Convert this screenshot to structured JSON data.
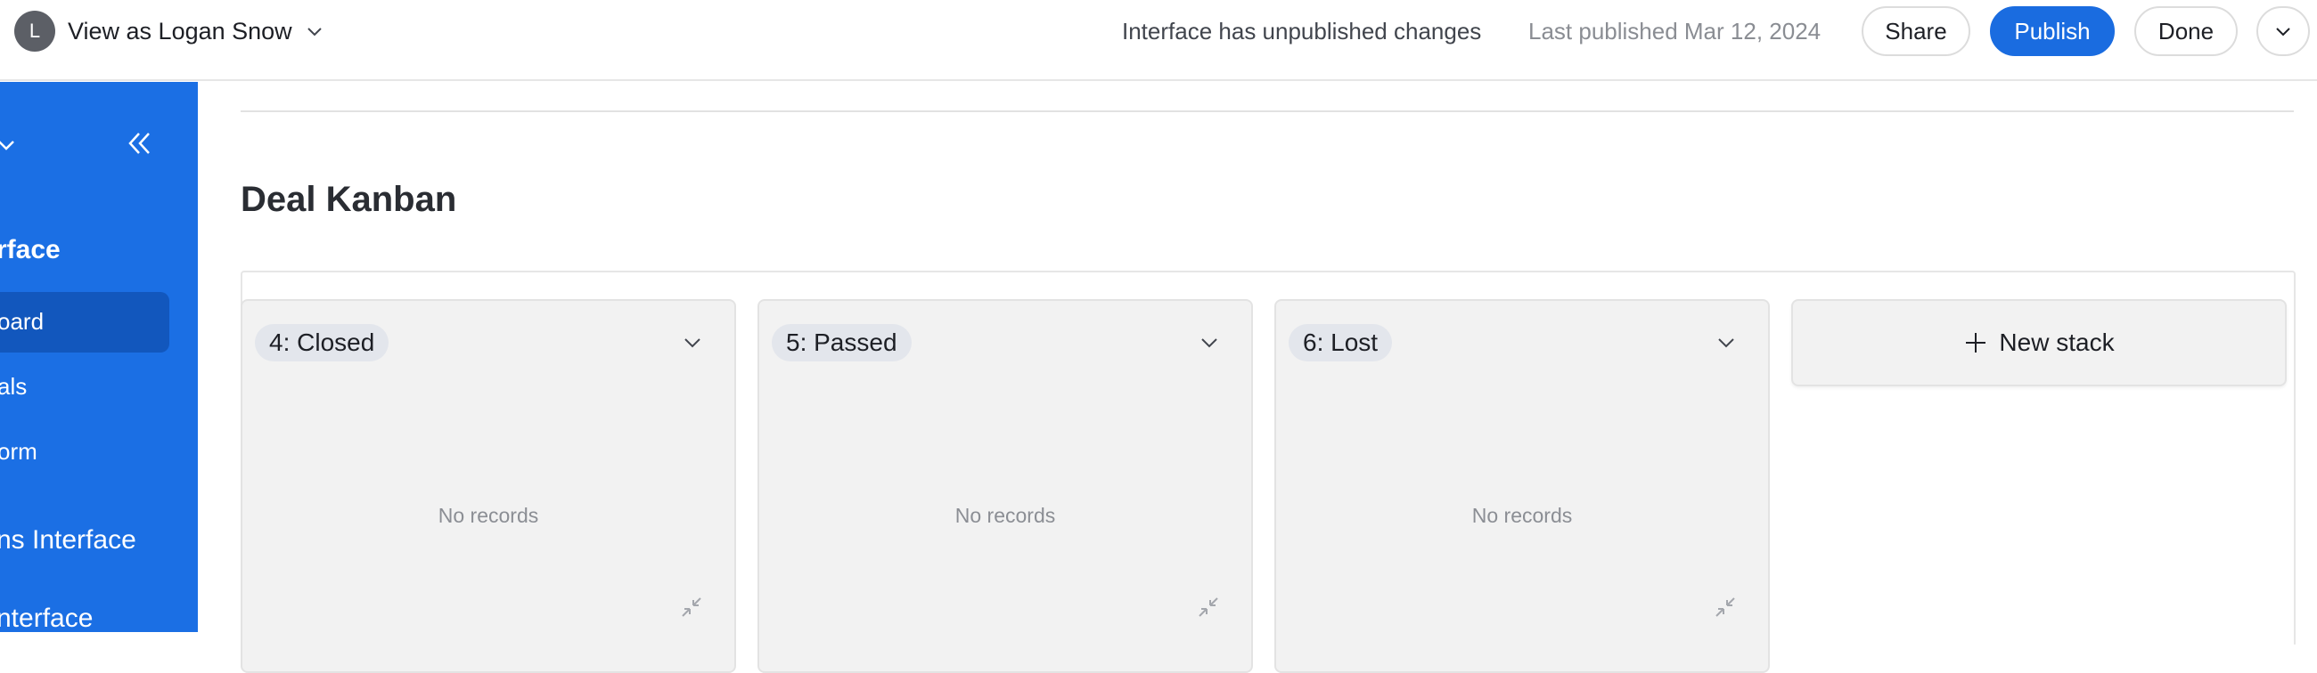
{
  "topbar": {
    "avatar_initial": "L",
    "view_as_label": "View as Logan Snow",
    "unpublished_text": "Interface has unpublished changes",
    "last_published_text": "Last published Mar 12, 2024",
    "share_label": "Share",
    "publish_label": "Publish",
    "done_label": "Done"
  },
  "sidebar": {
    "section_1": "rface",
    "items": [
      {
        "label": "oard"
      },
      {
        "label": "als"
      },
      {
        "label": "orm"
      }
    ],
    "section_2": "ns Interface",
    "section_3": "nterface"
  },
  "main": {
    "title": "Deal Kanban",
    "stacks": [
      {
        "label": "4: Closed",
        "empty_text": "No records"
      },
      {
        "label": "5: Passed",
        "empty_text": "No records"
      },
      {
        "label": "6: Lost",
        "empty_text": "No records"
      }
    ],
    "new_stack_label": "New stack"
  },
  "colors": {
    "accent": "#1a6ce0",
    "sidebar_bg": "#1b6fe4",
    "sidebar_active": "#1257bd",
    "stack_bg": "#f2f2f2"
  },
  "icons": {
    "view_as_chevron": "chevron-down-icon",
    "sidebar_dropdown": "chevron-down-icon",
    "sidebar_collapse": "double-chevron-left-icon",
    "stack_menu": "chevron-down-icon",
    "stack_collapse": "collapse-arrows-icon",
    "new_stack": "plus-icon",
    "more": "chevron-down-icon"
  }
}
